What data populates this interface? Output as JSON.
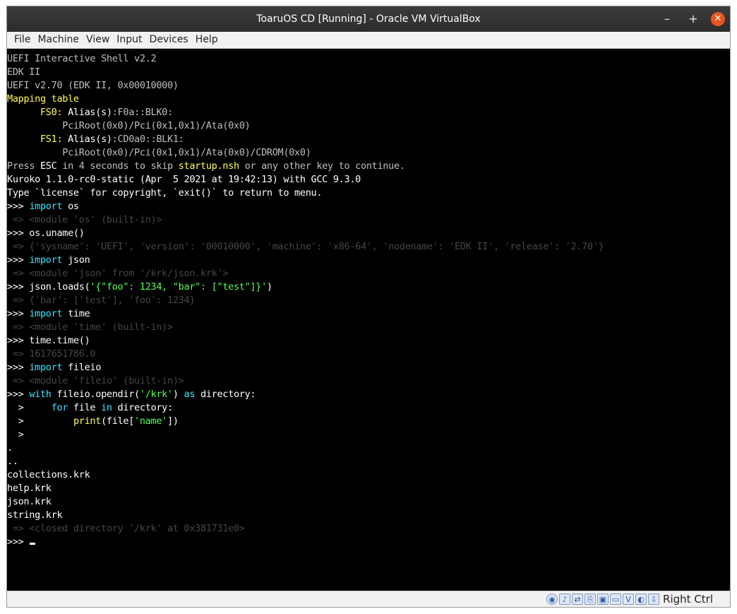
{
  "window": {
    "title": "ToaruOS CD [Running] - Oracle VM VirtualBox",
    "minimize_glyph": "–",
    "maximize_glyph": "+",
    "close_glyph": "✕"
  },
  "menubar": {
    "items": [
      "File",
      "Machine",
      "View",
      "Input",
      "Devices",
      "Help"
    ]
  },
  "terminal": {
    "lines": [
      [
        {
          "t": "UEFI Interactive Shell v2.2",
          "c": "gray"
        }
      ],
      [
        {
          "t": "EDK II",
          "c": "gray"
        }
      ],
      [
        {
          "t": "UEFI v2.70 (EDK II, 0x00010000)",
          "c": "gray"
        }
      ],
      [
        {
          "t": "Mapping table",
          "c": "yellow"
        }
      ],
      [
        {
          "t": "      ",
          "c": "default"
        },
        {
          "t": "FS0:",
          "c": "yellow"
        },
        {
          "t": " Alias(s)",
          "c": "white"
        },
        {
          "t": ":F0a::BLK0:",
          "c": "gray"
        }
      ],
      [
        {
          "t": "          PciRoot(0x0)/Pci(0x1,0x1)/Ata(0x0)",
          "c": "gray"
        }
      ],
      [
        {
          "t": "      ",
          "c": "default"
        },
        {
          "t": "FS1:",
          "c": "yellow"
        },
        {
          "t": " Alias(s)",
          "c": "white"
        },
        {
          "t": ":CD0a0::BLK1:",
          "c": "gray"
        }
      ],
      [
        {
          "t": "          PciRoot(0x0)/Pci(0x1,0x1)/Ata(0x0)/CDROM(0x0)",
          "c": "gray"
        }
      ],
      [
        {
          "t": "Press ",
          "c": "gray"
        },
        {
          "t": "ESC",
          "c": "white"
        },
        {
          "t": " in 4 seconds to skip ",
          "c": "gray"
        },
        {
          "t": "startup.nsh",
          "c": "yellow"
        },
        {
          "t": " or any other key to continue.",
          "c": "gray"
        }
      ],
      [
        {
          "t": "Kuroko 1.1.0-rc0-static (Apr  5 2021 at 19:42:13) with GCC 9.3.0",
          "c": "white"
        }
      ],
      [
        {
          "t": "Type `license` for copyright, `exit()` to return to menu.",
          "c": "white"
        }
      ],
      [
        {
          "t": ">>> ",
          "c": "white"
        },
        {
          "t": "import",
          "c": "kw"
        },
        {
          "t": " os",
          "c": "white"
        }
      ],
      [
        {
          "t": " => <module 'os' (built-in)>",
          "c": "dim"
        }
      ],
      [
        {
          "t": ">>> os.uname()",
          "c": "white"
        }
      ],
      [
        {
          "t": " => {'sysname': 'UEFI', 'version': '00010000', 'machine': 'x86-64', 'nodename': 'EDK II', 'release': '2.70'}",
          "c": "dim"
        }
      ],
      [
        {
          "t": ">>> ",
          "c": "white"
        },
        {
          "t": "import",
          "c": "kw"
        },
        {
          "t": " json",
          "c": "white"
        }
      ],
      [
        {
          "t": " => <module 'json' from '/krk/json.krk'>",
          "c": "dim"
        }
      ],
      [
        {
          "t": ">>> json.loads(",
          "c": "white"
        },
        {
          "t": "'{\"foo\": 1234, \"bar\": [\"test\"]}'",
          "c": "str"
        },
        {
          "t": ")",
          "c": "white"
        }
      ],
      [
        {
          "t": " => {'bar': ['test'], 'foo': 1234}",
          "c": "dim"
        }
      ],
      [
        {
          "t": ">>> ",
          "c": "white"
        },
        {
          "t": "import",
          "c": "kw"
        },
        {
          "t": " time",
          "c": "white"
        }
      ],
      [
        {
          "t": " => <module 'time' (built-in)>",
          "c": "dim"
        }
      ],
      [
        {
          "t": ">>> time.time()",
          "c": "white"
        }
      ],
      [
        {
          "t": " => 1617651786.0",
          "c": "dim"
        }
      ],
      [
        {
          "t": ">>> ",
          "c": "white"
        },
        {
          "t": "import",
          "c": "kw"
        },
        {
          "t": " fileio",
          "c": "white"
        }
      ],
      [
        {
          "t": " => <module 'fileio' (built-in)>",
          "c": "dim"
        }
      ],
      [
        {
          "t": ">>> ",
          "c": "white"
        },
        {
          "t": "with",
          "c": "kw"
        },
        {
          "t": " fileio.opendir(",
          "c": "white"
        },
        {
          "t": "'/krk'",
          "c": "str"
        },
        {
          "t": ") ",
          "c": "white"
        },
        {
          "t": "as",
          "c": "kw"
        },
        {
          "t": " directory:",
          "c": "white"
        }
      ],
      [
        {
          "t": "  >     ",
          "c": "white"
        },
        {
          "t": "for",
          "c": "kw"
        },
        {
          "t": " file ",
          "c": "white"
        },
        {
          "t": "in",
          "c": "kw"
        },
        {
          "t": " directory:",
          "c": "white"
        }
      ],
      [
        {
          "t": "  >         ",
          "c": "white"
        },
        {
          "t": "print",
          "c": "builtin"
        },
        {
          "t": "(file[",
          "c": "white"
        },
        {
          "t": "'name'",
          "c": "str"
        },
        {
          "t": "])",
          "c": "white"
        }
      ],
      [
        {
          "t": "  >",
          "c": "white"
        }
      ],
      [
        {
          "t": ".",
          "c": "white"
        }
      ],
      [
        {
          "t": "..",
          "c": "white"
        }
      ],
      [
        {
          "t": "collections.krk",
          "c": "white"
        }
      ],
      [
        {
          "t": "help.krk",
          "c": "white"
        }
      ],
      [
        {
          "t": "json.krk",
          "c": "white"
        }
      ],
      [
        {
          "t": "string.krk",
          "c": "white"
        }
      ],
      [
        {
          "t": " => <closed directory '/krk' at 0x381731e0>",
          "c": "dim"
        }
      ],
      [
        {
          "t": ">>> ",
          "c": "white"
        }
      ]
    ]
  },
  "statusbar": {
    "icons": [
      "optical-drive-icon",
      "audio-icon",
      "network-icon",
      "usb-icon",
      "shared-folder-icon",
      "display-icon",
      "video-capture-icon",
      "mouse-integration-icon",
      "host-key-arrow-icon"
    ],
    "icon_glyphs": [
      "◉",
      "♪",
      "⇄",
      "⎘",
      "▣",
      "▭",
      "V",
      "◐",
      "⇩"
    ],
    "host_key": "Right Ctrl"
  }
}
